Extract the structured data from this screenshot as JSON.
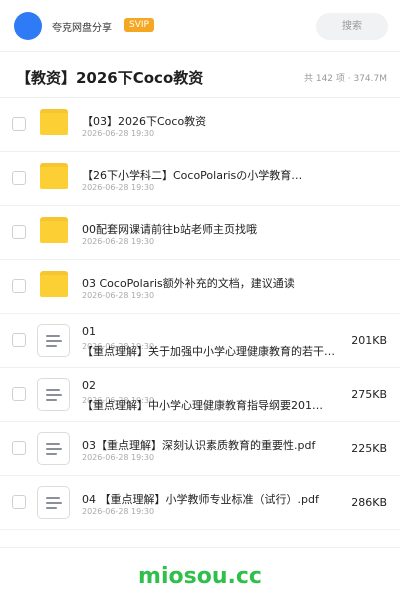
{
  "header": {
    "brand": "夸克网盘分享",
    "badge": "SVIP",
    "search_label": "搜索",
    "avatar_color": "#2f7bf5"
  },
  "folder": {
    "title": "【教资】2026下Coco教资",
    "meta": "共 142 项 · 374.7M"
  },
  "items": [
    {
      "type": "folder",
      "name": "【03】2026下Coco教资",
      "date": "2026-06-28 19:30"
    },
    {
      "type": "folder",
      "name": "【26下小学科二】CocoPolarisの小学教育…",
      "date": "2026-06-28 19:30"
    },
    {
      "type": "folder",
      "name": "00配套网课请前往b站老师主页找哦",
      "date": "2026-06-28 19:30"
    },
    {
      "type": "folder",
      "name": "03 CocoPolaris额外补充的文档，建议通读",
      "date": "2026-06-28 19:30"
    },
    {
      "type": "file",
      "name": "01",
      "subname": "【重点理解】关于加强中小学心理健康教育的若干…",
      "date": "2026-06-28 19:30",
      "size": "201KB"
    },
    {
      "type": "file",
      "name": "02",
      "subname": "【重点理解】中小学心理健康教育指导纲要201…",
      "date": "2026-06-28 19:30",
      "size": "275KB"
    },
    {
      "type": "file",
      "name": "03【重点理解】深刻认识素质教育的重要性.pdf",
      "date": "2026-06-28 19:30",
      "size": "225KB"
    },
    {
      "type": "file",
      "name": "04 【重点理解】小学教师专业标准（试行）.pdf",
      "date": "2026-06-28 19:30",
      "size": "286KB"
    }
  ],
  "watermark": "miosou.cc",
  "colors": {
    "folder": "#fcd034",
    "badge": "#f5a623",
    "watermark": "#2fbf4a"
  }
}
